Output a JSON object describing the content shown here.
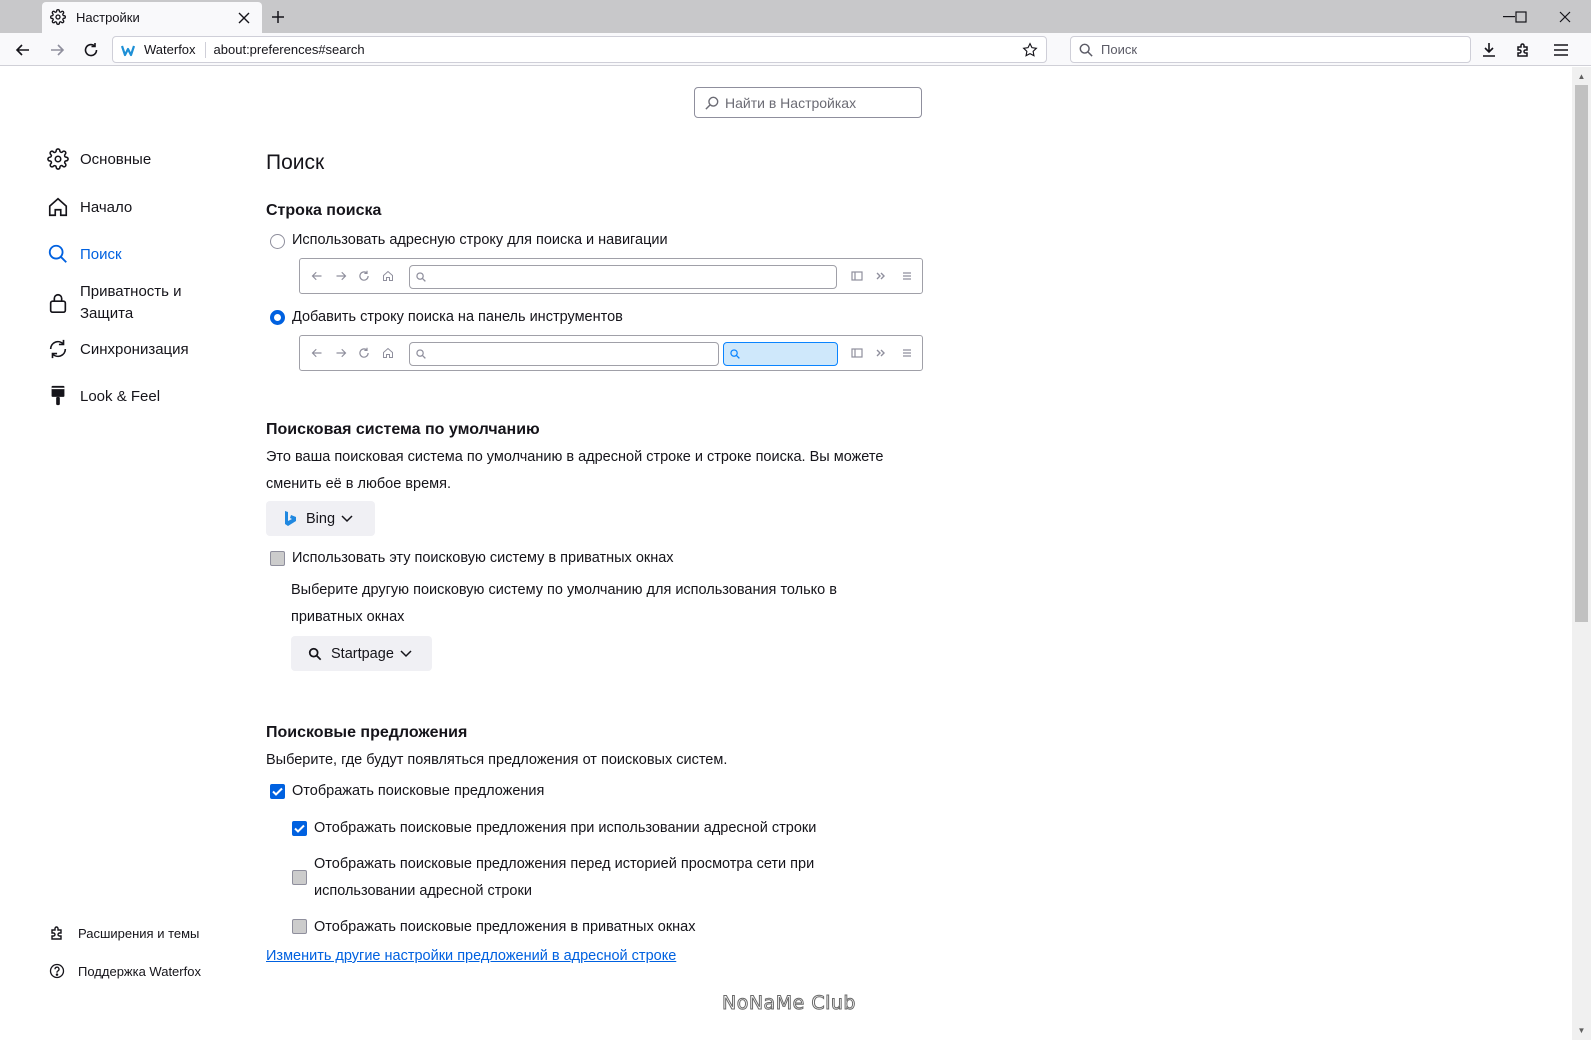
{
  "tab": {
    "title": "Настройки"
  },
  "url_bar": {
    "brand": "Waterfox",
    "url": "about:preferences#search"
  },
  "search_bar": {
    "placeholder": "Поиск"
  },
  "find_in_settings": {
    "placeholder": "Найти в Настройках"
  },
  "sidebar": {
    "categories": [
      {
        "label": "Основные",
        "icon": "gear-icon"
      },
      {
        "label": "Начало",
        "icon": "home-icon"
      },
      {
        "label": "Поиск",
        "icon": "search-icon",
        "selected": true
      },
      {
        "label": "Приватность и",
        "label2": "Защита",
        "icon": "lock-icon"
      },
      {
        "label": "Синхронизация",
        "icon": "sync-icon"
      },
      {
        "label": "Look & Feel",
        "icon": "paintbrush-icon"
      }
    ],
    "footer": [
      {
        "label": "Расширения и темы",
        "icon": "puzzle-icon"
      },
      {
        "label": "Поддержка Waterfox",
        "icon": "help-icon"
      }
    ]
  },
  "page": {
    "title": "Поиск",
    "search_bar_section": {
      "heading": "Строка поиска",
      "option_address": "Использовать адресную строку для поиска и навигации",
      "option_toolbar": "Добавить строку поиска на панель инструментов",
      "selected": "option_toolbar"
    },
    "default_engine_section": {
      "heading": "Поисковая система по умолчанию",
      "desc_line1": "Это ваша поисковая система по умолчанию в адресной строке и строке поиска. Вы можете",
      "desc_line2": "сменить её в любое время.",
      "engine": "Bing",
      "private_checkbox": "Использовать эту поисковую систему в приватных окнах",
      "private_checked": false,
      "private_desc_line1": "Выберите другую поисковую систему по умолчанию для использования только в",
      "private_desc_line2": "приватных окнах",
      "private_engine": "Startpage"
    },
    "suggestions_section": {
      "heading": "Поисковые предложения",
      "desc": "Выберите, где будут появляться предложения от поисковых систем.",
      "show_suggestions": "Отображать поисковые предложения",
      "show_suggestions_checked": true,
      "in_address_bar": "Отображать поисковые предложения при использовании адресной строки",
      "in_address_bar_checked": true,
      "before_history_line1": "Отображать поисковые предложения перед историей просмотра сети при",
      "before_history_line2": "использовании адресной строки",
      "before_history_checked": false,
      "in_private": "Отображать поисковые предложения в приватных окнах",
      "in_private_checked": false,
      "change_link": "Изменить другие настройки предложений в адресной строке"
    }
  },
  "watermark": "NoNaMe Club",
  "colors": {
    "accent": "#0061e0",
    "tabstrip": "#c8c8ca",
    "toolbar": "#f9f9fb"
  }
}
